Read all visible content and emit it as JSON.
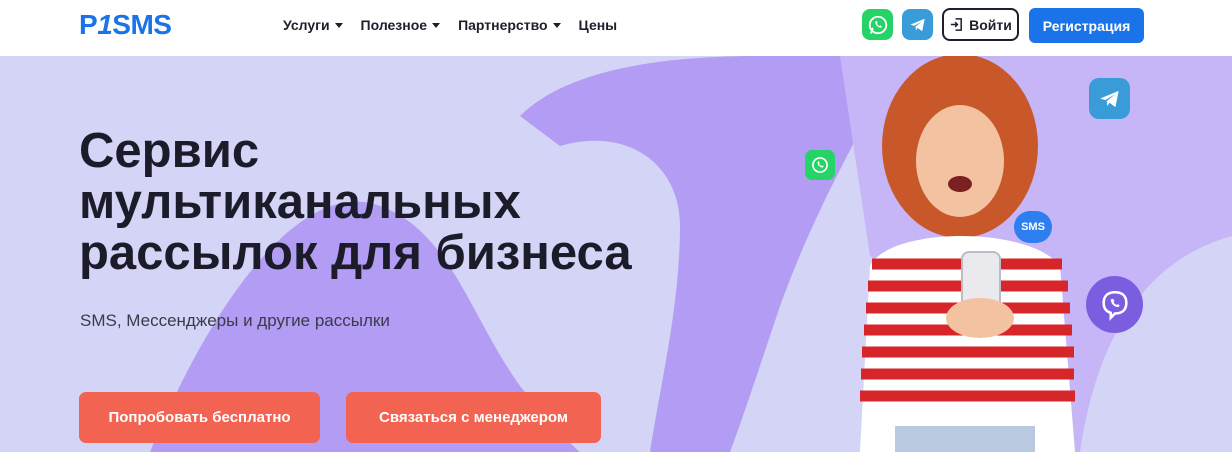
{
  "header": {
    "logo": {
      "left": "P",
      "accent": "1",
      "right": "SMS"
    },
    "nav": [
      {
        "label": "Услуги",
        "has_dropdown": true
      },
      {
        "label": "Полезное",
        "has_dropdown": true
      },
      {
        "label": "Партнерство",
        "has_dropdown": true
      },
      {
        "label": "Цены",
        "has_dropdown": false
      }
    ],
    "login_label": "Войти",
    "register_label": "Регистрация"
  },
  "hero": {
    "title_lines": [
      "Сервис",
      "мультиканальных",
      "рассылок для бизнеса"
    ],
    "subtitle": "SMS, Мессенджеры и другие рассылки",
    "cta_try": "Попробовать бесплатно",
    "cta_manager": "Связаться с менеджером",
    "sms_bubble": "SMS"
  },
  "colors": {
    "brand_blue": "#1a73e8",
    "cta_red": "#f26352",
    "hero_bg": "#d3d4f6",
    "hero_shape": "#b39cf3",
    "whatsapp": "#25d366",
    "telegram": "#3a9bd9",
    "viber": "#7b5ee0"
  },
  "icons": [
    "whatsapp-icon",
    "telegram-icon",
    "login-icon",
    "viber-icon",
    "sms-bubble-icon"
  ]
}
